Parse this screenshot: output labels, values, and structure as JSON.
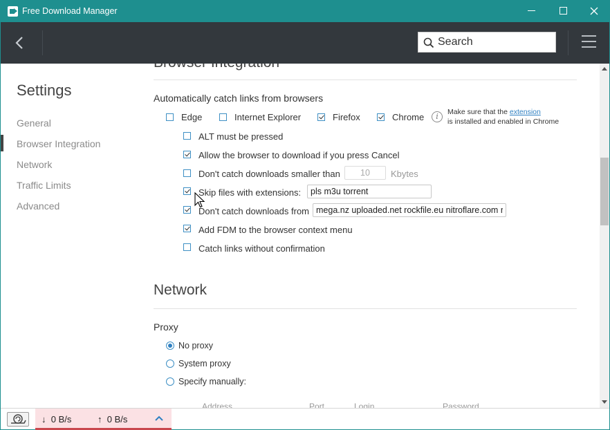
{
  "window": {
    "title": "Free Download Manager",
    "minimize_label": "Minimize",
    "maximize_label": "Maximize",
    "close_label": "Close"
  },
  "toolbar": {
    "search_placeholder": "Search"
  },
  "sidebar": {
    "title": "Settings",
    "items": [
      {
        "label": "General"
      },
      {
        "label": "Browser Integration",
        "active": true
      },
      {
        "label": "Network"
      },
      {
        "label": "Traffic Limits"
      },
      {
        "label": "Advanced"
      }
    ]
  },
  "browser_integration": {
    "title": "Browser Integration",
    "catch_links_label": "Automatically catch links from browsers",
    "browsers": [
      {
        "label": "Edge",
        "checked": false
      },
      {
        "label": "Internet Explorer",
        "checked": false
      },
      {
        "label": "Firefox",
        "checked": true
      },
      {
        "label": "Chrome",
        "checked": true
      }
    ],
    "note_prefix": "Make sure that the",
    "note_link": "extension",
    "note_suffix": "is installed and enabled in Chrome",
    "options": {
      "alt_pressed": {
        "label": "ALT must be pressed",
        "checked": false
      },
      "allow_cancel": {
        "label": "Allow the browser to download if you press Cancel",
        "checked": true
      },
      "min_size": {
        "label": "Don't catch downloads smaller than",
        "checked": false,
        "value": "10",
        "unit": "Kbytes"
      },
      "skip_ext": {
        "label": "Skip files with extensions:",
        "checked": true,
        "value": "pls m3u torrent"
      },
      "skip_from": {
        "label": "Don't catch downloads from",
        "checked": true,
        "value": "mega.nz uploaded.net rockfile.eu nitroflare.com ra"
      },
      "context_menu": {
        "label": "Add FDM to the browser context menu",
        "checked": true
      },
      "no_confirm": {
        "label": "Catch links without confirmation",
        "checked": false
      }
    }
  },
  "network": {
    "title": "Network",
    "proxy_label": "Proxy",
    "proxy_options": [
      {
        "label": "No proxy",
        "checked": true
      },
      {
        "label": "System proxy",
        "checked": false
      },
      {
        "label": "Specify manually:",
        "checked": false
      }
    ],
    "columns": [
      "Address",
      "Port",
      "Login",
      "Password"
    ]
  },
  "statusbar": {
    "download_speed": "0 B/s",
    "upload_speed": "0 B/s",
    "down_arrow": "↓",
    "up_arrow": "↑"
  }
}
